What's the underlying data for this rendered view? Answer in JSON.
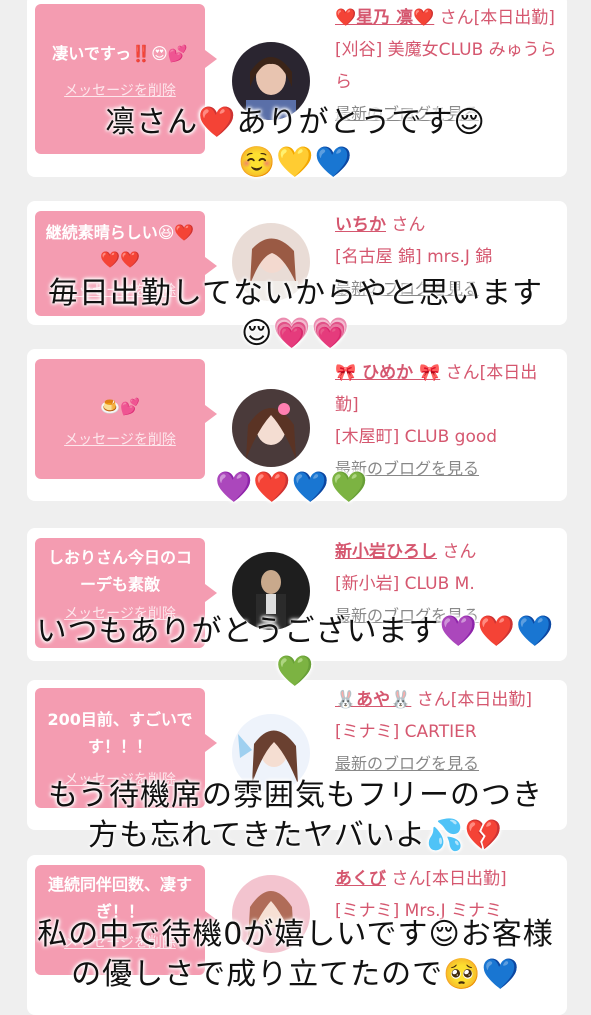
{
  "delete_label": "メッセージを削除",
  "blog_label": "最新のブログを見る",
  "cards": [
    {
      "message": "凄いですっ‼️😍💕",
      "name": "❤️星乃 凛❤️",
      "suffix": "さん[本日出勤]",
      "shop": "[刈谷] 美魔女CLUB みゅうらら"
    },
    {
      "message": "継続素晴らしい😆❤️❤️❤️",
      "name": "いちか",
      "suffix": "さん",
      "shop": "[名古屋 錦] mrs.J 錦"
    },
    {
      "message": "🍮💕",
      "name": "🎀 ひめか 🎀",
      "suffix": "さん[本日出勤]",
      "shop": "[木屋町] CLUB good"
    },
    {
      "message": "しおりさん今日のコーデも素敵",
      "name": "新小岩ひろし",
      "suffix": "さん",
      "shop": "[新小岩] CLUB M."
    },
    {
      "message": "200目前、すごいです！！！",
      "name": "🐰あや🐰",
      "suffix": "さん[本日出勤]",
      "shop": "[ミナミ] CARTIER"
    },
    {
      "message": "連続同伴回数、凄すぎ！！",
      "name": "あくび",
      "suffix": "さん[本日出勤]",
      "shop": "[ミナミ] Mrs.J ミナミ"
    }
  ],
  "overlays": [
    {
      "line1": "凛さん❤️ありがとうです😌",
      "line2": "☺️💛💙"
    },
    {
      "line1": "毎日出勤してないからやと思います",
      "line2": "😌💗💗"
    },
    {
      "line1": "💜❤️💙💚",
      "line2": ""
    },
    {
      "line1": "いつもありがとうございます💜❤️💙",
      "line2": "💚"
    },
    {
      "line1": "もう待機席の雰囲気もフリーのつき",
      "line2": "方も忘れてきたヤバいよ💦💔"
    },
    {
      "line1": "私の中で待機0が嬉しいです😌お客様",
      "line2": "の優しさで成り立てたので🥺💙"
    }
  ]
}
